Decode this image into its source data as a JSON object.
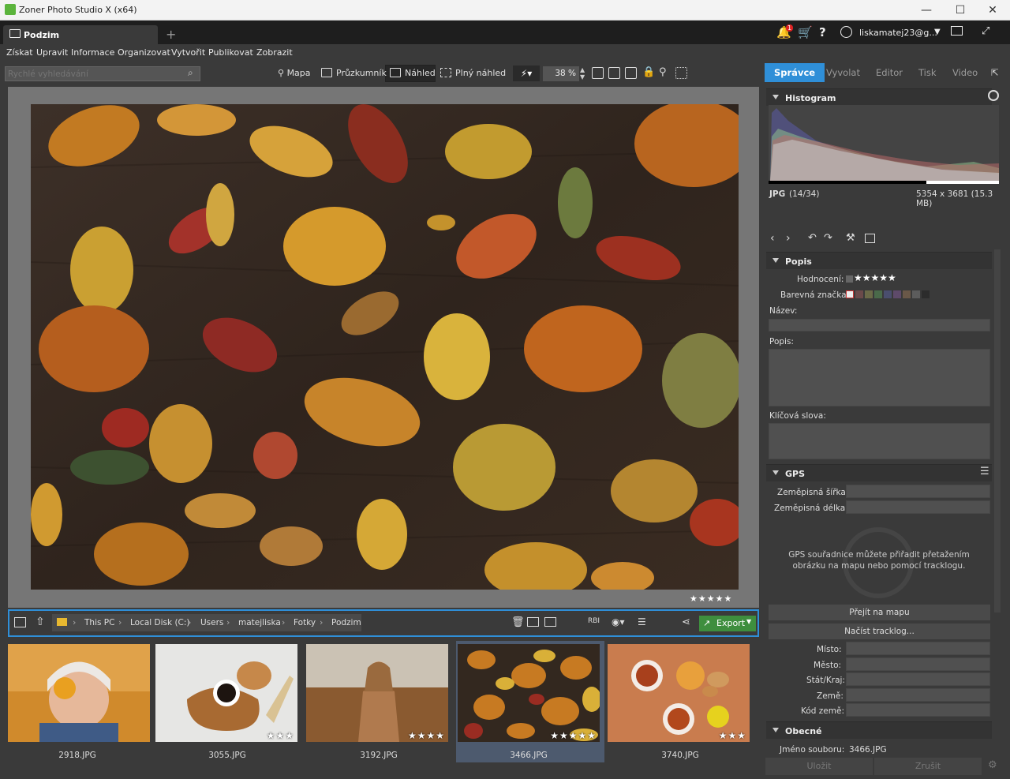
{
  "window": {
    "title": "Zoner Photo Studio X (x64)",
    "minimize": "—",
    "maximize": "☐",
    "close": "✕"
  },
  "topbar": {
    "tab_label": "Podzim",
    "new_tab": "+",
    "notif_badge": "1",
    "help": "?",
    "user": "liskamatej23@g..."
  },
  "menu": [
    "Získat",
    "Upravit",
    "Informace",
    "Organizovat",
    "Vytvořit",
    "Publikovat",
    "Zobrazit"
  ],
  "toolbar": {
    "search_placeholder": "Rychlé vyhledávání",
    "map": "Mapa",
    "explorer": "Průzkumník",
    "preview": "Náhled",
    "fullpreview": "Plný náhled",
    "zoom": "38 %"
  },
  "modes": {
    "manager": "Správce",
    "develop": "Vyvolat",
    "editor": "Editor",
    "print": "Tisk",
    "video": "Video"
  },
  "viewer": {
    "stars": "★★★★★"
  },
  "path": {
    "items": [
      "This PC",
      "Local Disk (C:)",
      "Users",
      "matejliska",
      "Fotky",
      "Podzim"
    ],
    "export": "Export"
  },
  "thumbs": [
    {
      "name": "2918.JPG",
      "stars": ""
    },
    {
      "name": "3055.JPG",
      "stars": "★★★"
    },
    {
      "name": "3192.JPG",
      "stars": "★★★★"
    },
    {
      "name": "3466.JPG",
      "stars": "★★★★★"
    },
    {
      "name": "3740.JPG",
      "stars": "★★★"
    }
  ],
  "panel": {
    "histogram": "Histogram",
    "format": "JPG",
    "index": "(14/34)",
    "dims": "5354 x 3681 (15.3 MB)",
    "popis": "Popis",
    "rating_label": "Hodnocení:",
    "rating": "★★★★★",
    "color_label": "Barevná značka:",
    "name_label": "Název:",
    "desc_label": "Popis:",
    "keywords_label": "Klíčová slova:",
    "gps": "GPS",
    "lat_label": "Zeměpisná šířka:",
    "lon_label": "Zeměpisná délka:",
    "gps_hint": "GPS souřadnice můžete přiřadit přetažením obrázku na mapu nebo pomocí tracklogu.",
    "btn_map": "Přejít na mapu",
    "btn_track": "Načíst tracklog...",
    "place_label": "Místo:",
    "city_label": "Město:",
    "state_label": "Stát/Kraj:",
    "country_label": "Země:",
    "code_label": "Kód země:",
    "general": "Obecné",
    "filename_label": "Jméno souboru:",
    "filename": "3466.JPG",
    "save": "Uložit",
    "cancel": "Zrušit"
  },
  "colors": {
    "accent": "#2f8fd8",
    "export": "#3e8e3e"
  }
}
